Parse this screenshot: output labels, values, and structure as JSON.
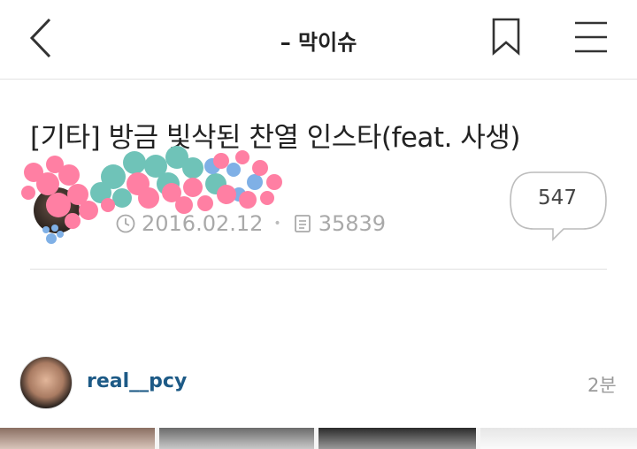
{
  "header": {
    "title": "–  막이슈",
    "back_icon": "chevron-left-icon",
    "bookmark_icon": "bookmark-icon",
    "menu_icon": "hamburger-menu-icon"
  },
  "post": {
    "title": "[기타] 방금 빛삭된 찬열 인스타(feat. 사생)",
    "date": "2016.02.12",
    "views": "35839",
    "comments": "547",
    "date_icon": "clock-icon",
    "views_icon": "document-icon"
  },
  "instagram": {
    "username": "real__pcy",
    "time": "2분"
  },
  "colors": {
    "scribble_pink": "#ff7fa3",
    "scribble_teal": "#6fc3b8",
    "scribble_blue": "#7fb0e6",
    "username_blue": "#1d5a86",
    "meta_gray": "#a9a9a9"
  }
}
